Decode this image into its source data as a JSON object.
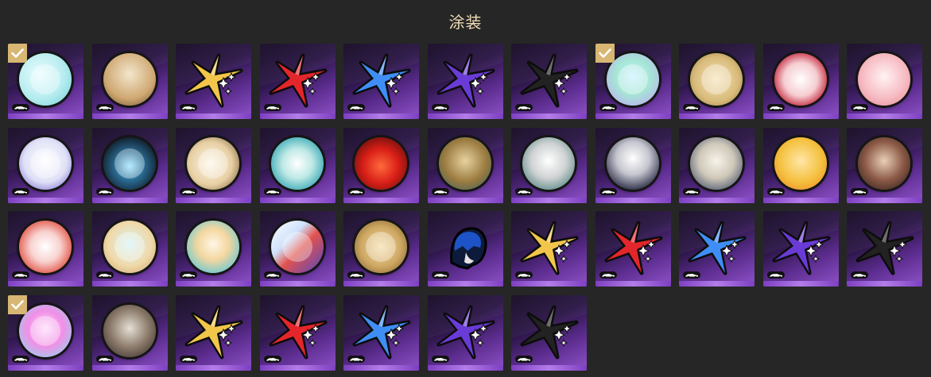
{
  "title": "涂装",
  "colors": {
    "title": "#f1dfb8",
    "check": "#d8b673",
    "background": "#262626"
  },
  "items": [
    {
      "type": "badge",
      "bg": "radial-gradient(circle at 40% 40%, #eafcff 0%, #b5ecef 55%, #6fd1d6 100%)",
      "checked": true
    },
    {
      "type": "badge",
      "bg": "radial-gradient(circle at 50% 40%, #f3e6cc 0%, #cfa872 60%, #6b4a2c 100%)",
      "pc": true,
      "checked": false
    },
    {
      "type": "spark",
      "color": "#f2c64a",
      "checked": false
    },
    {
      "type": "spark",
      "color": "#e3262b",
      "checked": false
    },
    {
      "type": "spark",
      "color": "#3e8ef5",
      "checked": false
    },
    {
      "type": "spark",
      "color": "#6a3bd6",
      "checked": false
    },
    {
      "type": "spark",
      "color": "#222222",
      "checked": false
    },
    {
      "type": "badge",
      "bg": "radial-gradient(circle at 50% 45%, #c7f2ff 0%, #a5e6d5 45%, #c59ef7 100%)",
      "checked": true
    },
    {
      "type": "badge",
      "bg": "radial-gradient(circle at 50% 50%, #f5e3b8 0%, #d8bb7a 60%, #8f7240 100%)",
      "checked": false
    },
    {
      "type": "badge",
      "bg": "radial-gradient(circle at 50% 50%, #ffffff 0%, #f5cdd1 45%, #c9374b 75%, #2f4d9f 100%)",
      "pc": true,
      "checked": false
    },
    {
      "type": "badge",
      "bg": "radial-gradient(circle at 50% 45%, #fff3f3 0%, #f7bcc4 55%, #e5858f 100%)",
      "pc": true,
      "checked": false
    },
    {
      "type": "badge",
      "bg": "radial-gradient(circle at 50% 45%, #ffffff 0%, #dfe0f6 55%, #6650c7 100%)",
      "checked": false
    },
    {
      "type": "badge",
      "bg": "radial-gradient(circle at 50% 55%, #8ee3ff 0%, #2b6f97 35%, #12202e 75%)",
      "checked": false
    },
    {
      "type": "badge",
      "bg": "radial-gradient(circle at 45% 50%, #fdf6e7 0%, #e7cfa3 55%, #6b4c2a 100%)",
      "checked": false
    },
    {
      "type": "badge",
      "bg": "radial-gradient(circle at 50% 50%, #ffffff 0%, #bfe9e6 40%, #37a8b4 80%)",
      "pc": true,
      "checked": false
    },
    {
      "type": "badge",
      "bg": "radial-gradient(circle at 50% 55%, #ff6a3c 0%, #d81e17 45%, #3a0b08 100%)",
      "pc": true,
      "checked": false
    },
    {
      "type": "badge",
      "bg": "radial-gradient(circle at 50% 45%, #e7d2a0 0%, #9a7a3f 55%, #2e5f69 100%)",
      "pc": true,
      "checked": false
    },
    {
      "type": "badge",
      "bg": "radial-gradient(circle at 50% 45%, #ffffff 0%, #cfd2d3 45%, #2b6b64 100%)",
      "pc": true,
      "checked": false
    },
    {
      "type": "badge",
      "bg": "radial-gradient(circle at 50% 40%, #ffffff 0%, #c6c6d0 40%, #2c2e46 80%)",
      "pc": true,
      "checked": false
    },
    {
      "type": "badge",
      "bg": "radial-gradient(circle at 50% 45%, #f7f3ea 0%, #cfc8b9 45%, #1f2f55 100%)",
      "pc": true,
      "checked": false
    },
    {
      "type": "badge",
      "bg": "radial-gradient(circle at 50% 45%, #ffe7a8 0%, #f4c03e 55%, #ec7a1d 100%)",
      "pc": true,
      "checked": false
    },
    {
      "type": "badge",
      "bg": "radial-gradient(circle at 50% 45%, #e9cfb7 0%, #8c5a47 50%, #201515 100%)",
      "pc": true,
      "checked": false
    },
    {
      "type": "badge",
      "bg": "radial-gradient(circle at 50% 50%, #ffffff 0%, #f8d3d1 40%, #e04d3e 80%)",
      "pc": true,
      "checked": false
    },
    {
      "type": "badge",
      "bg": "radial-gradient(circle at 50% 45%, #d3f4f7 0%, #f0d9a9 55%, #c8a26a 100%)",
      "checked": false
    },
    {
      "type": "badge",
      "bg": "radial-gradient(circle at 50% 45%, #fff6e6 0%, #f3d7a0 40%, #5fc6d4 85%)",
      "pc": true,
      "checked": false
    },
    {
      "type": "badge",
      "bg": "linear-gradient(135deg, #ffffff 0%, #cfe1fb 35%, #e2534e 55%, #5146c4 100%)",
      "checked": false
    },
    {
      "type": "badge",
      "bg": "radial-gradient(circle at 50% 50%, #f5dca6 0%, #cda661 55%, #6d5226 100%)",
      "checked": false
    },
    {
      "type": "portrait",
      "color": "#1d53c6",
      "checked": false
    },
    {
      "type": "spark",
      "color": "#f2c64a",
      "checked": false
    },
    {
      "type": "spark",
      "color": "#e3262b",
      "checked": false
    },
    {
      "type": "spark",
      "color": "#3e8ef5",
      "checked": false
    },
    {
      "type": "spark",
      "color": "#6a3bd6",
      "checked": false
    },
    {
      "type": "spark",
      "color": "#222222",
      "checked": false
    },
    {
      "type": "badge",
      "bg": "radial-gradient(circle at 50% 45%, #ffd9fb 0%, #f18fe6 45%, #7fe3ee 100%)",
      "checked": true
    },
    {
      "type": "badge",
      "bg": "radial-gradient(circle at 50% 45%, #e6e0d6 0%, #8b7a6a 50%, #2a2222 100%)",
      "pc": true,
      "checked": false
    },
    {
      "type": "spark",
      "color": "#f2c64a",
      "checked": false
    },
    {
      "type": "spark",
      "color": "#e3262b",
      "checked": false
    },
    {
      "type": "spark",
      "color": "#3e8ef5",
      "checked": false
    },
    {
      "type": "spark",
      "color": "#6a3bd6",
      "checked": false
    },
    {
      "type": "spark",
      "color": "#222222",
      "checked": false
    }
  ]
}
